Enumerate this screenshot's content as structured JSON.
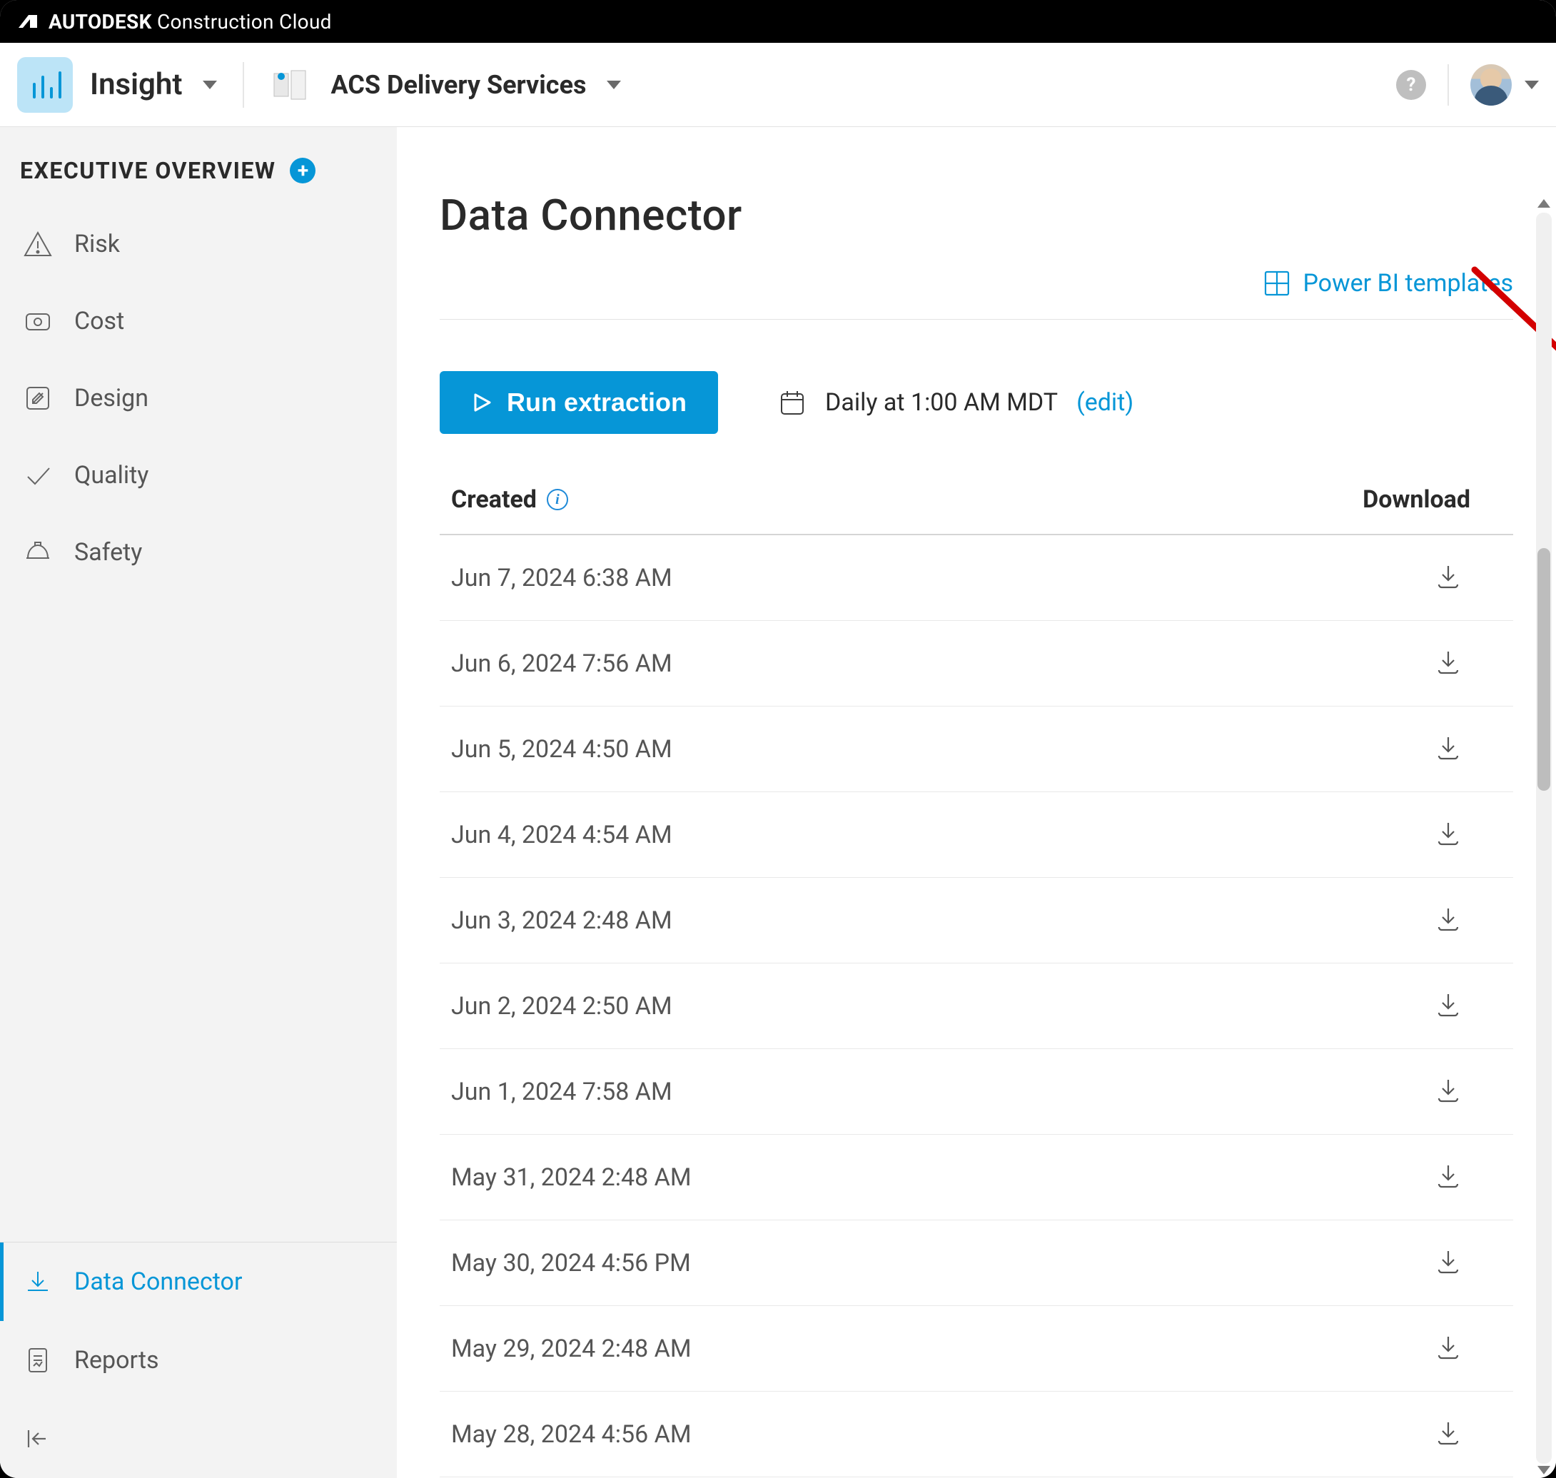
{
  "brand": {
    "company": "AUTODESK",
    "product": "Construction Cloud"
  },
  "header": {
    "module": "Insight",
    "project": "ACS Delivery Services"
  },
  "sidebar": {
    "section_title": "EXECUTIVE OVERVIEW",
    "items": [
      {
        "label": "Risk"
      },
      {
        "label": "Cost"
      },
      {
        "label": "Design"
      },
      {
        "label": "Quality"
      },
      {
        "label": "Safety"
      }
    ],
    "bottom": [
      {
        "label": "Data Connector",
        "active": true
      },
      {
        "label": "Reports",
        "active": false
      }
    ]
  },
  "page": {
    "title": "Data Connector",
    "pbi_link": "Power BI templates",
    "run_button": "Run extraction",
    "schedule_text": "Daily at 1:00 AM MDT",
    "schedule_edit": "(edit)"
  },
  "table": {
    "header_created": "Created",
    "header_download": "Download",
    "rows": [
      {
        "created": "Jun 7, 2024 6:38 AM"
      },
      {
        "created": "Jun 6, 2024 7:56 AM"
      },
      {
        "created": "Jun 5, 2024 4:50 AM"
      },
      {
        "created": "Jun 4, 2024 4:54 AM"
      },
      {
        "created": "Jun 3, 2024 2:48 AM"
      },
      {
        "created": "Jun 2, 2024 2:50 AM"
      },
      {
        "created": "Jun 1, 2024 7:58 AM"
      },
      {
        "created": "May 31, 2024 2:48 AM"
      },
      {
        "created": "May 30, 2024 4:56 PM"
      },
      {
        "created": "May 29, 2024 2:48 AM"
      },
      {
        "created": "May 28, 2024 4:56 AM"
      }
    ]
  },
  "colors": {
    "accent": "#0696d7"
  }
}
